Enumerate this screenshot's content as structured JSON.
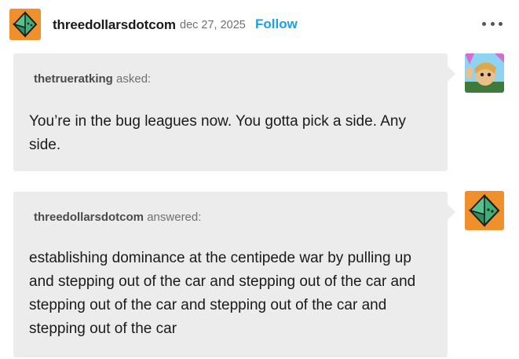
{
  "header": {
    "blog_name": "threedollarsdotcom",
    "date": "dec 27, 2025",
    "follow_label": "Follow",
    "avatar_icon": "d8-dice-avatar-icon",
    "more_icon": "more-options-icon"
  },
  "ask": {
    "asker": "thetrueratking",
    "verb": "asked:",
    "text": "You’re in the bug leagues now. You gotta pick a side. Any side.",
    "avatar_icon": "cartoon-character-avatar-icon"
  },
  "answer": {
    "answerer": "threedollarsdotcom",
    "verb": "answered:",
    "text": "establishing dominance at the centipede war by pulling up and stepping out of the car and stepping out of the car and stepping out of the car and stepping out of the car and stepping out of the car",
    "avatar_icon": "d8-dice-avatar-icon"
  },
  "colors": {
    "accent": "#1ca0e8",
    "avatar_bg": "#f0902d",
    "bubble_bg": "#ececec"
  }
}
